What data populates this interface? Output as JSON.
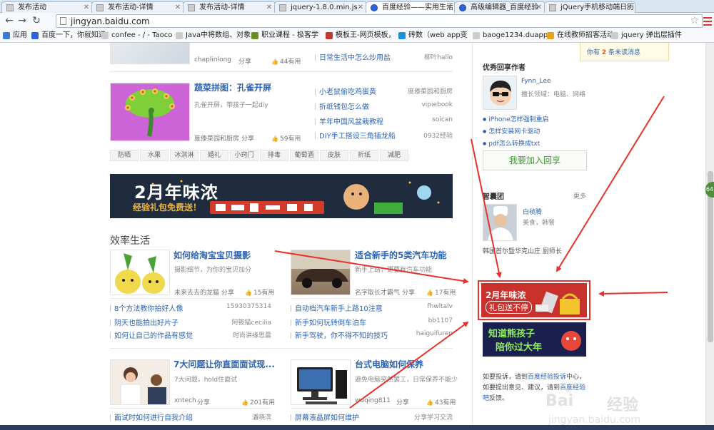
{
  "browser": {
    "tabs": [
      {
        "label": "发布活动",
        "active": false
      },
      {
        "label": "发布活动-详情",
        "active": false
      },
      {
        "label": "发布活动-详情",
        "active": false
      },
      {
        "label": "jquery-1.8.0.min.js",
        "active": false
      },
      {
        "label": "百度经验——实用生活",
        "active": true
      },
      {
        "label": "高级编辑器_百度经验",
        "active": false
      },
      {
        "label": "jQuery手机移动端日历",
        "active": false
      }
    ],
    "address": "jingyan.baidu.com",
    "bookmarks": [
      "应用",
      "百度一下，你就知道",
      "confee - / - Taoco",
      "Java中将数组、对象",
      "职业课程 - 极客学",
      "模板王-网页模板，",
      "砖数（web app变",
      "baoge1234.duapp",
      "在线教师招客活动",
      "jquery 弹出层插件"
    ]
  },
  "top_fragment": {
    "author": "chaplinlong",
    "share": "分享",
    "useful": "44有用",
    "links": [
      {
        "text": "日常生活中怎么炒用盐",
        "author": "柳叶hallo"
      }
    ]
  },
  "feature_item": {
    "title": "蔬菜拼图：孔雀开屏",
    "desc": "孔雀开屏，带孩子一起diy",
    "author": "度傣菜园和厨房",
    "share": "分享",
    "useful": "59有用",
    "links": [
      {
        "text": "小老鼠偷吃鸡蛋黄",
        "author": "度傣菜园和厨房"
      },
      {
        "text": "折纸钱包怎么做",
        "author": "vipiebook"
      },
      {
        "text": "羊年中国风盆栽教程",
        "author": "soican"
      },
      {
        "text": "DIY手工搭设三角插龙船",
        "author": "0932经验"
      }
    ]
  },
  "tags": [
    "防晒",
    "水果",
    "冰淇淋",
    "婚礼",
    "小窍门",
    "排毒",
    "葡萄酒",
    "皮肤",
    "折纸",
    "减肥"
  ],
  "banner": {
    "title": "2月年味浓",
    "subtitle": "经验礼包免费送！"
  },
  "section": {
    "title": "效率生活",
    "articles": [
      {
        "title": "如何给淘宝宝贝摄影",
        "desc": "摄影细节，为你的宝贝加分",
        "author": "未来去去的龙猫",
        "share": "分享",
        "useful": "15有用",
        "links": [
          {
            "text": "8个方法教你拍好人像",
            "author": "15930375314"
          },
          {
            "text": "阴天也能拍出好片子",
            "author": "阿筱猫cecilia"
          },
          {
            "text": "如何让自己的作品有感觉",
            "author": "时尚讲缘思晨"
          }
        ]
      },
      {
        "title": "适合新手的5类汽车功能",
        "desc": "新手上路，更要有汽车功能",
        "author": "名字取长才霸气",
        "share": "分享",
        "useful": "17有用",
        "links": [
          {
            "text": "自动档汽车新手上路10注意",
            "author": "fhwltalv"
          },
          {
            "text": "新手如何玩转倒车泊车",
            "author": "bb1107"
          },
          {
            "text": "新手驾驶，你不得不知的技巧",
            "author": "haiguifuren"
          }
        ]
      },
      {
        "title": "7大问题让你直面面试现...",
        "desc": "7大问题，hold住面试",
        "author": "xntech",
        "share": "分享",
        "useful": "201有用",
        "links": [
          {
            "text": "面试时如何进行自我介绍",
            "author": "潘晓滨"
          }
        ]
      },
      {
        "title": "台式电脑如何保养",
        "desc": "避免电脑突然罢工，日常保养不能少",
        "author": "wuqing811",
        "share": "分享",
        "useful": "43有用",
        "links": [
          {
            "text": "屏幕液晶屏如何维护",
            "author": "分享学习交流"
          }
        ]
      }
    ]
  },
  "sidebar": {
    "notice": {
      "prefix": "你有",
      "count": "2",
      "suffix": "条未读消息"
    },
    "good_author": {
      "heading": "优秀回享作者",
      "name": "Fynn_Lee",
      "desc": "擅长领域：电脑、网络",
      "links": [
        "iPhone怎样强制重启",
        "怎样安装网卡驱动",
        "pdf怎么转换成txt"
      ],
      "join": "我要加入回享"
    },
    "think_tank": {
      "heading": "智囊团",
      "more": "更多",
      "name": "白祯腾",
      "desc": "美食，韩餐",
      "caption": "韩国首尔暨华克山庄  厨师长"
    },
    "ad1": {
      "line1": "2月年味浓",
      "line2": "礼包送不停"
    },
    "ad2": {
      "line1": "知道熊孩子",
      "line2": "陪你过大年"
    },
    "complaint": {
      "p1": "如要投诉，请到",
      "link1": "百度经验投诉",
      "p2": "中心，如要提出意见、建议，请到",
      "link2": "百度经验吧",
      "p3": "反馈。"
    }
  },
  "watermark": {
    "brand": "Bai",
    "cn": "经验",
    "domain": "jingyan.baidu.com"
  },
  "side_tab": "64"
}
